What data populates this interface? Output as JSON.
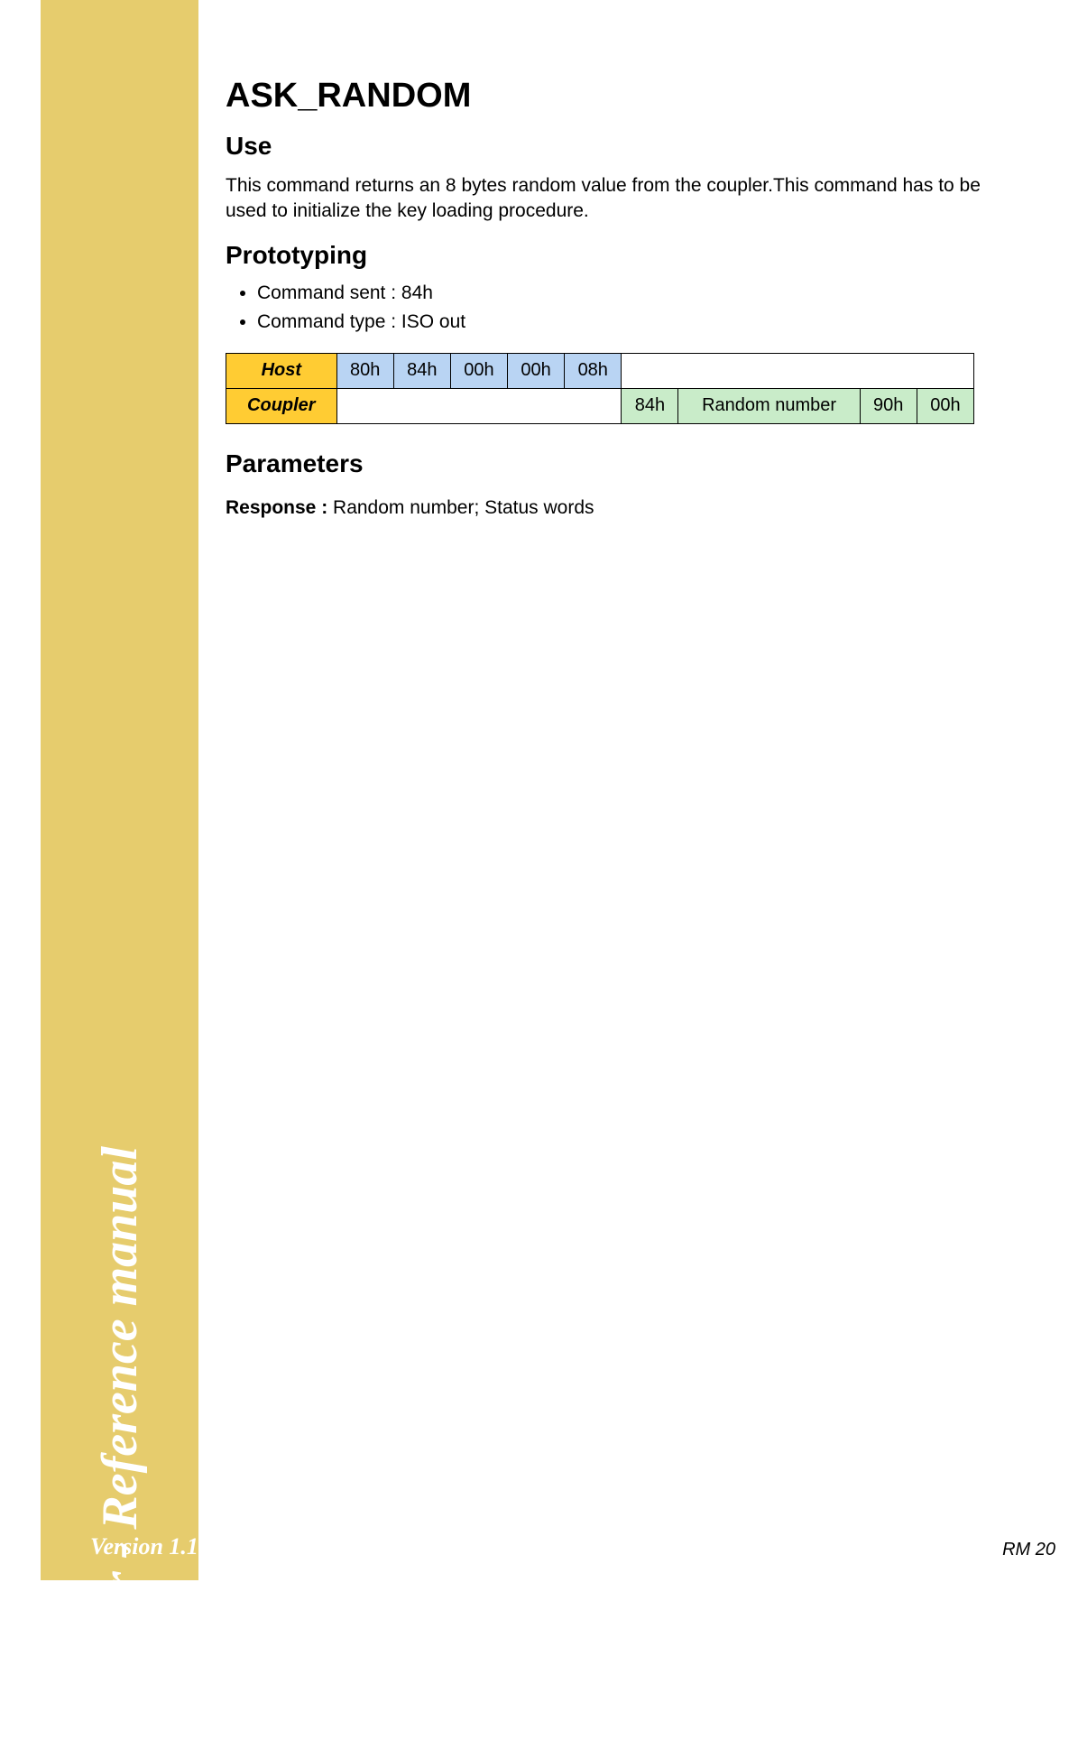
{
  "sidebar": {
    "title": "Coupler - Reference manual",
    "version": "Version 1.1"
  },
  "page": {
    "title": "ASK_RANDOM",
    "pagenum": "RM 20"
  },
  "use": {
    "heading": "Use",
    "text": "This command returns an 8 bytes random value from the coupler.This command has to be used to initialize the key loading procedure."
  },
  "proto": {
    "heading": "Prototyping",
    "bullet1": "Command sent : 84h",
    "bullet2": "Command type : ISO out",
    "host_label": "Host",
    "coupler_label": "Coupler",
    "host_cells": [
      "80h",
      "84h",
      "00h",
      "00h",
      "08h"
    ],
    "coupler_cells": [
      "84h",
      "Random number",
      "90h",
      "00h"
    ]
  },
  "params": {
    "heading": "Parameters",
    "resp_label": "Response : ",
    "resp_text": "Random number; Status words"
  }
}
